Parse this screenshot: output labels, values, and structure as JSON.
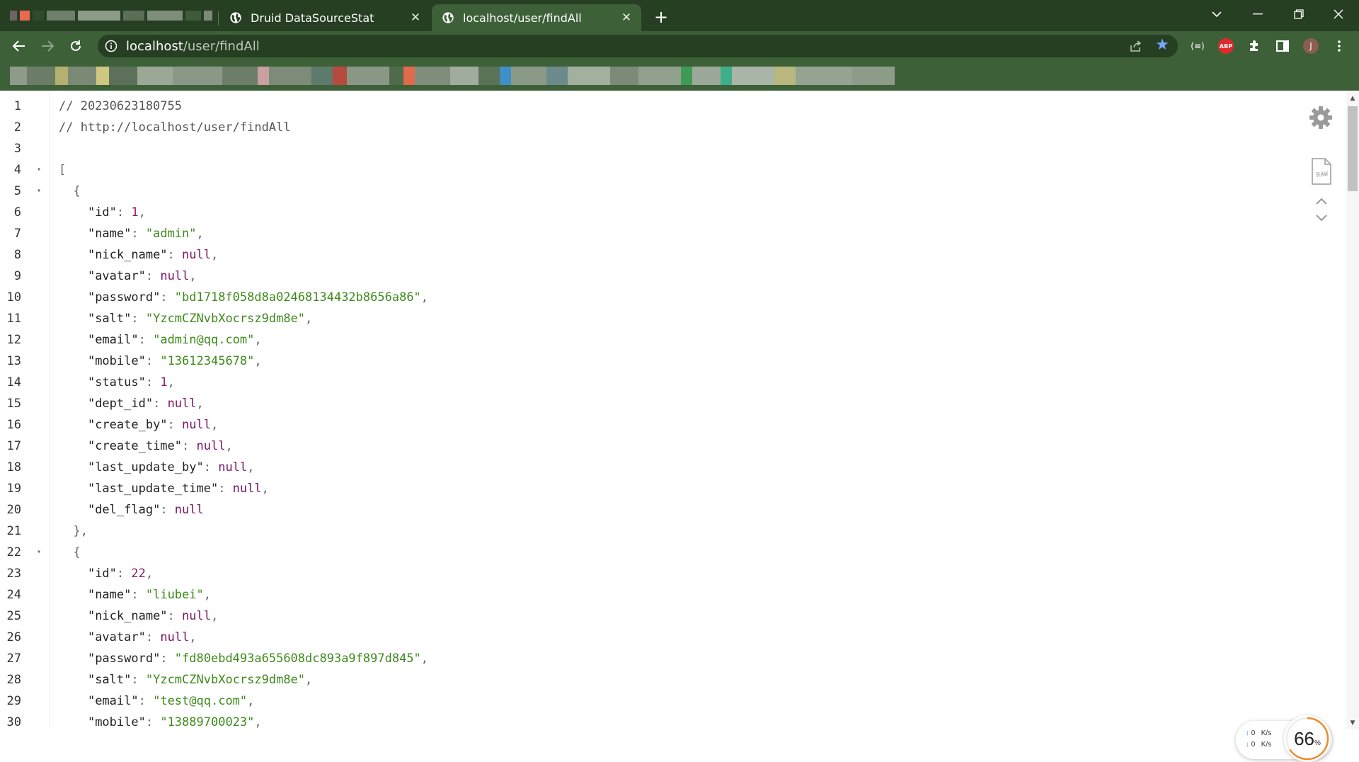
{
  "browser": {
    "tabs": [
      {
        "title": "Druid DataSourceStat",
        "active": false
      },
      {
        "title": "localhost/user/findAll",
        "active": true
      }
    ],
    "close_glyph": "✕",
    "new_tab_glyph": "+",
    "window_controls": {
      "dropdown": "⌄",
      "minimize": "—",
      "restore": "❐",
      "close": "✕"
    },
    "url_host": "localhost",
    "url_path": "/user/findAll",
    "avatar_letter": "J",
    "abp_label": "ABP",
    "ext_label": "(≡)",
    "icons": [
      "globe-icon",
      "back-arrow-icon",
      "forward-arrow-icon",
      "reload-icon",
      "info-icon",
      "share-icon",
      "star-icon",
      "puzzle-icon",
      "sidebar-icon",
      "menu-dots-icon"
    ],
    "colors": {
      "frame": "#263e22",
      "toolbar": "#3d6038",
      "star": "#7aa7ff"
    }
  },
  "json_view": {
    "lines": [
      {
        "n": "1",
        "fold": false,
        "text": "// 20230623180755"
      },
      {
        "n": "2",
        "fold": false,
        "text": "// http://localhost/user/findAll"
      },
      {
        "n": "3",
        "fold": false,
        "text": ""
      },
      {
        "n": "4",
        "fold": true,
        "text": "["
      },
      {
        "n": "5",
        "fold": true,
        "text": "  {"
      },
      {
        "n": "6",
        "fold": false,
        "text": "    \"id\": 1,"
      },
      {
        "n": "7",
        "fold": false,
        "text": "    \"name\": \"admin\","
      },
      {
        "n": "8",
        "fold": false,
        "text": "    \"nick_name\": null,"
      },
      {
        "n": "9",
        "fold": false,
        "text": "    \"avatar\": null,"
      },
      {
        "n": "10",
        "fold": false,
        "text": "    \"password\": \"bd1718f058d8a02468134432b8656a86\","
      },
      {
        "n": "11",
        "fold": false,
        "text": "    \"salt\": \"YzcmCZNvbXocrsz9dm8e\","
      },
      {
        "n": "12",
        "fold": false,
        "text": "    \"email\": \"admin@qq.com\","
      },
      {
        "n": "13",
        "fold": false,
        "text": "    \"mobile\": \"13612345678\","
      },
      {
        "n": "14",
        "fold": false,
        "text": "    \"status\": 1,"
      },
      {
        "n": "15",
        "fold": false,
        "text": "    \"dept_id\": null,"
      },
      {
        "n": "16",
        "fold": false,
        "text": "    \"create_by\": null,"
      },
      {
        "n": "17",
        "fold": false,
        "text": "    \"create_time\": null,"
      },
      {
        "n": "18",
        "fold": false,
        "text": "    \"last_update_by\": null,"
      },
      {
        "n": "19",
        "fold": false,
        "text": "    \"last_update_time\": null,"
      },
      {
        "n": "20",
        "fold": false,
        "text": "    \"del_flag\": null"
      },
      {
        "n": "21",
        "fold": false,
        "text": "  },"
      },
      {
        "n": "22",
        "fold": true,
        "text": "  {"
      },
      {
        "n": "23",
        "fold": false,
        "text": "    \"id\": 22,"
      },
      {
        "n": "24",
        "fold": false,
        "text": "    \"name\": \"liubei\","
      },
      {
        "n": "25",
        "fold": false,
        "text": "    \"nick_name\": null,"
      },
      {
        "n": "26",
        "fold": false,
        "text": "    \"avatar\": null,"
      },
      {
        "n": "27",
        "fold": false,
        "text": "    \"password\": \"fd80ebd493a655608dc893a9f897d845\","
      },
      {
        "n": "28",
        "fold": false,
        "text": "    \"salt\": \"YzcmCZNvbXocrsz9dm8e\","
      },
      {
        "n": "29",
        "fold": false,
        "text": "    \"email\": \"test@qq.com\","
      },
      {
        "n": "30",
        "fold": false,
        "text": "    \"mobile\": \"13889700023\","
      }
    ],
    "fold_glyph": "▾",
    "colors": {
      "string": "#3e8a1b",
      "number": "#8b1c5b",
      "null": "#7b1462",
      "comment": "#555555"
    }
  },
  "tools": {
    "raw_label": "RAW"
  },
  "net_widget": {
    "up_value": "0",
    "down_value": "0",
    "unit": "K/s",
    "up_arrow": "↑",
    "down_arrow": "↓",
    "percent": "66",
    "percent_sign": "%",
    "percent_fraction": 0.66,
    "ring_color": "#f08a2c"
  }
}
